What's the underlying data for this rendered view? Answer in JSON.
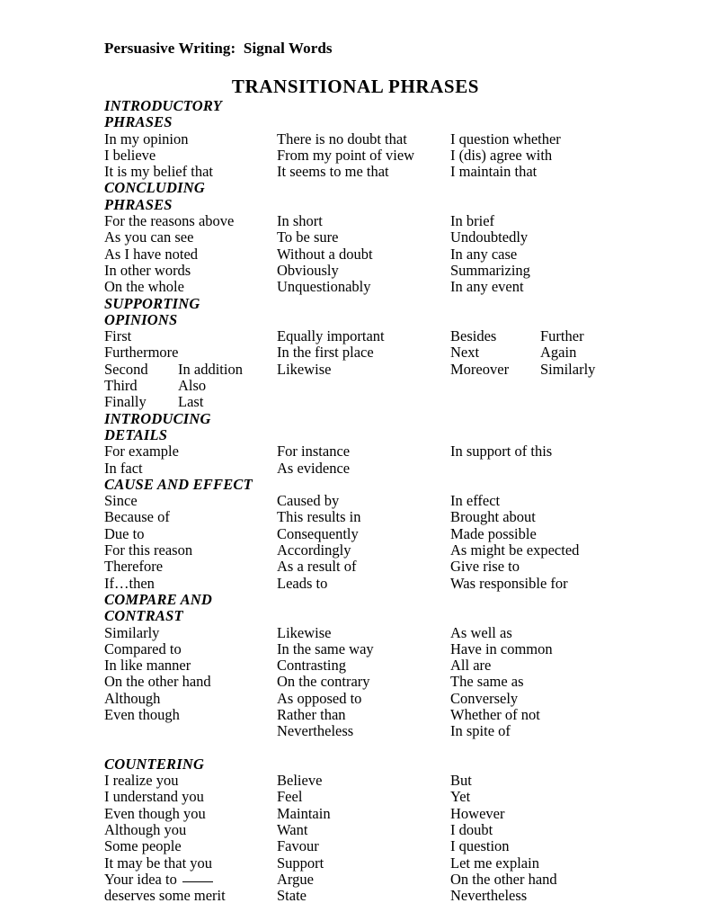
{
  "document": {
    "header": "Persuasive Writing:  Signal Words",
    "title": "TRANSITIONAL PHRASES"
  },
  "sections": [
    {
      "heading_lines": [
        "INTRODUCTORY",
        "PHRASES"
      ],
      "rows": [
        {
          "c1": "In my opinion",
          "c2": "There is no doubt that",
          "c3": "I question whether"
        },
        {
          "c1": "I believe",
          "c2": "From my point of view",
          "c3": "I (dis) agree with"
        },
        {
          "c1": "It is my belief that",
          "c2": "It seems to me that",
          "c3": "I maintain that"
        }
      ]
    },
    {
      "heading_lines": [
        "CONCLUDING",
        "PHRASES"
      ],
      "rows": [
        {
          "c1": "For the reasons above",
          "c2": "In short",
          "c3": "In brief"
        },
        {
          "c1": "As you can see",
          "c2": "To be sure",
          "c3": "Undoubtedly"
        },
        {
          "c1": "As I have noted",
          "c2": "Without a doubt",
          "c3": "In any case"
        },
        {
          "c1": "In other words",
          "c2": "Obviously",
          "c3": "Summarizing"
        },
        {
          "c1": "On the whole",
          "c2": "Unquestionably",
          "c3": "In any event"
        }
      ]
    },
    {
      "heading_lines": [
        "SUPPORTING",
        "OPINIONS"
      ],
      "rows": [
        {
          "c1": "First",
          "c1b": "",
          "c2": "Equally important",
          "c3": "Besides",
          "c3b": "Further"
        },
        {
          "c1": "Furthermore",
          "c1b": "",
          "c2": "In the first place",
          "c3": "Next",
          "c3b": "Again"
        },
        {
          "c1": "Second",
          "c1b": "In addition",
          "c2": "Likewise",
          "c3": "Moreover",
          "c3b": "Similarly"
        },
        {
          "c1": "Third",
          "c1b": "Also",
          "c2": "",
          "c3": "",
          "c3b": ""
        },
        {
          "c1": "Finally",
          "c1b": "Last",
          "c2": "",
          "c3": "",
          "c3b": ""
        }
      ]
    },
    {
      "heading_lines": [
        "INTRODUCING",
        "DETAILS"
      ],
      "rows": [
        {
          "c1": "For example",
          "c2": "For instance",
          "c3": "In support of this"
        },
        {
          "c1": "In fact",
          "c2": "As evidence",
          "c3": ""
        }
      ]
    },
    {
      "heading_lines": [
        "CAUSE AND EFFECT"
      ],
      "rows": [
        {
          "c1": "Since",
          "c2": "Caused by",
          "c3": "In effect"
        },
        {
          "c1": "Because of",
          "c2": "This results in",
          "c3": "Brought about"
        },
        {
          "c1": "Due to",
          "c2": "Consequently",
          "c3": "Made possible"
        },
        {
          "c1": "For this reason",
          "c2": "Accordingly",
          "c3": "As might be expected"
        },
        {
          "c1": "Therefore",
          "c2": "As a result of",
          "c3": "Give rise to"
        },
        {
          "c1": "If…then",
          "c2": "Leads to",
          "c3": "Was responsible for"
        }
      ]
    },
    {
      "heading_lines": [
        "COMPARE AND",
        "CONTRAST"
      ],
      "rows": [
        {
          "c1": "Similarly",
          "c2": "Likewise",
          "c3": "As well as"
        },
        {
          "c1": "Compared to",
          "c2": "In the same way",
          "c3": "Have in common"
        },
        {
          "c1": "In like manner",
          "c2": "Contrasting",
          "c3": "All are"
        },
        {
          "c1": "On the other hand",
          "c2": "On the contrary",
          "c3": "The same as"
        },
        {
          "c1": "Although",
          "c2": "As opposed to",
          "c3": "Conversely"
        },
        {
          "c1": "Even though",
          "c2": "Rather than",
          "c3": "Whether of not"
        },
        {
          "c1": "",
          "c2": "Nevertheless",
          "c3": "In spite of"
        }
      ]
    },
    {
      "blank_before": true,
      "heading_lines": [
        "COUNTERING"
      ],
      "rows": [
        {
          "c1": "I realize you",
          "c2": "Believe",
          "c3": "But"
        },
        {
          "c1": "I understand you",
          "c2": "Feel",
          "c3": "Yet"
        },
        {
          "c1": "Even though you",
          "c2": "Maintain",
          "c3": "However"
        },
        {
          "c1": "Although you",
          "c2": "Want",
          "c3": "I doubt"
        },
        {
          "c1": "Some people",
          "c2": "Favour",
          "c3": "I question"
        },
        {
          "c1": "It may be that you",
          "c2": "Support",
          "c3": "Let me explain"
        },
        {
          "c1": "Your idea to ",
          "c1_blank": true,
          "c2": "Argue",
          "c3": "On the other hand"
        },
        {
          "c1": "deserves some merit",
          "c2": "State",
          "c3": "Nevertheless"
        }
      ]
    }
  ]
}
